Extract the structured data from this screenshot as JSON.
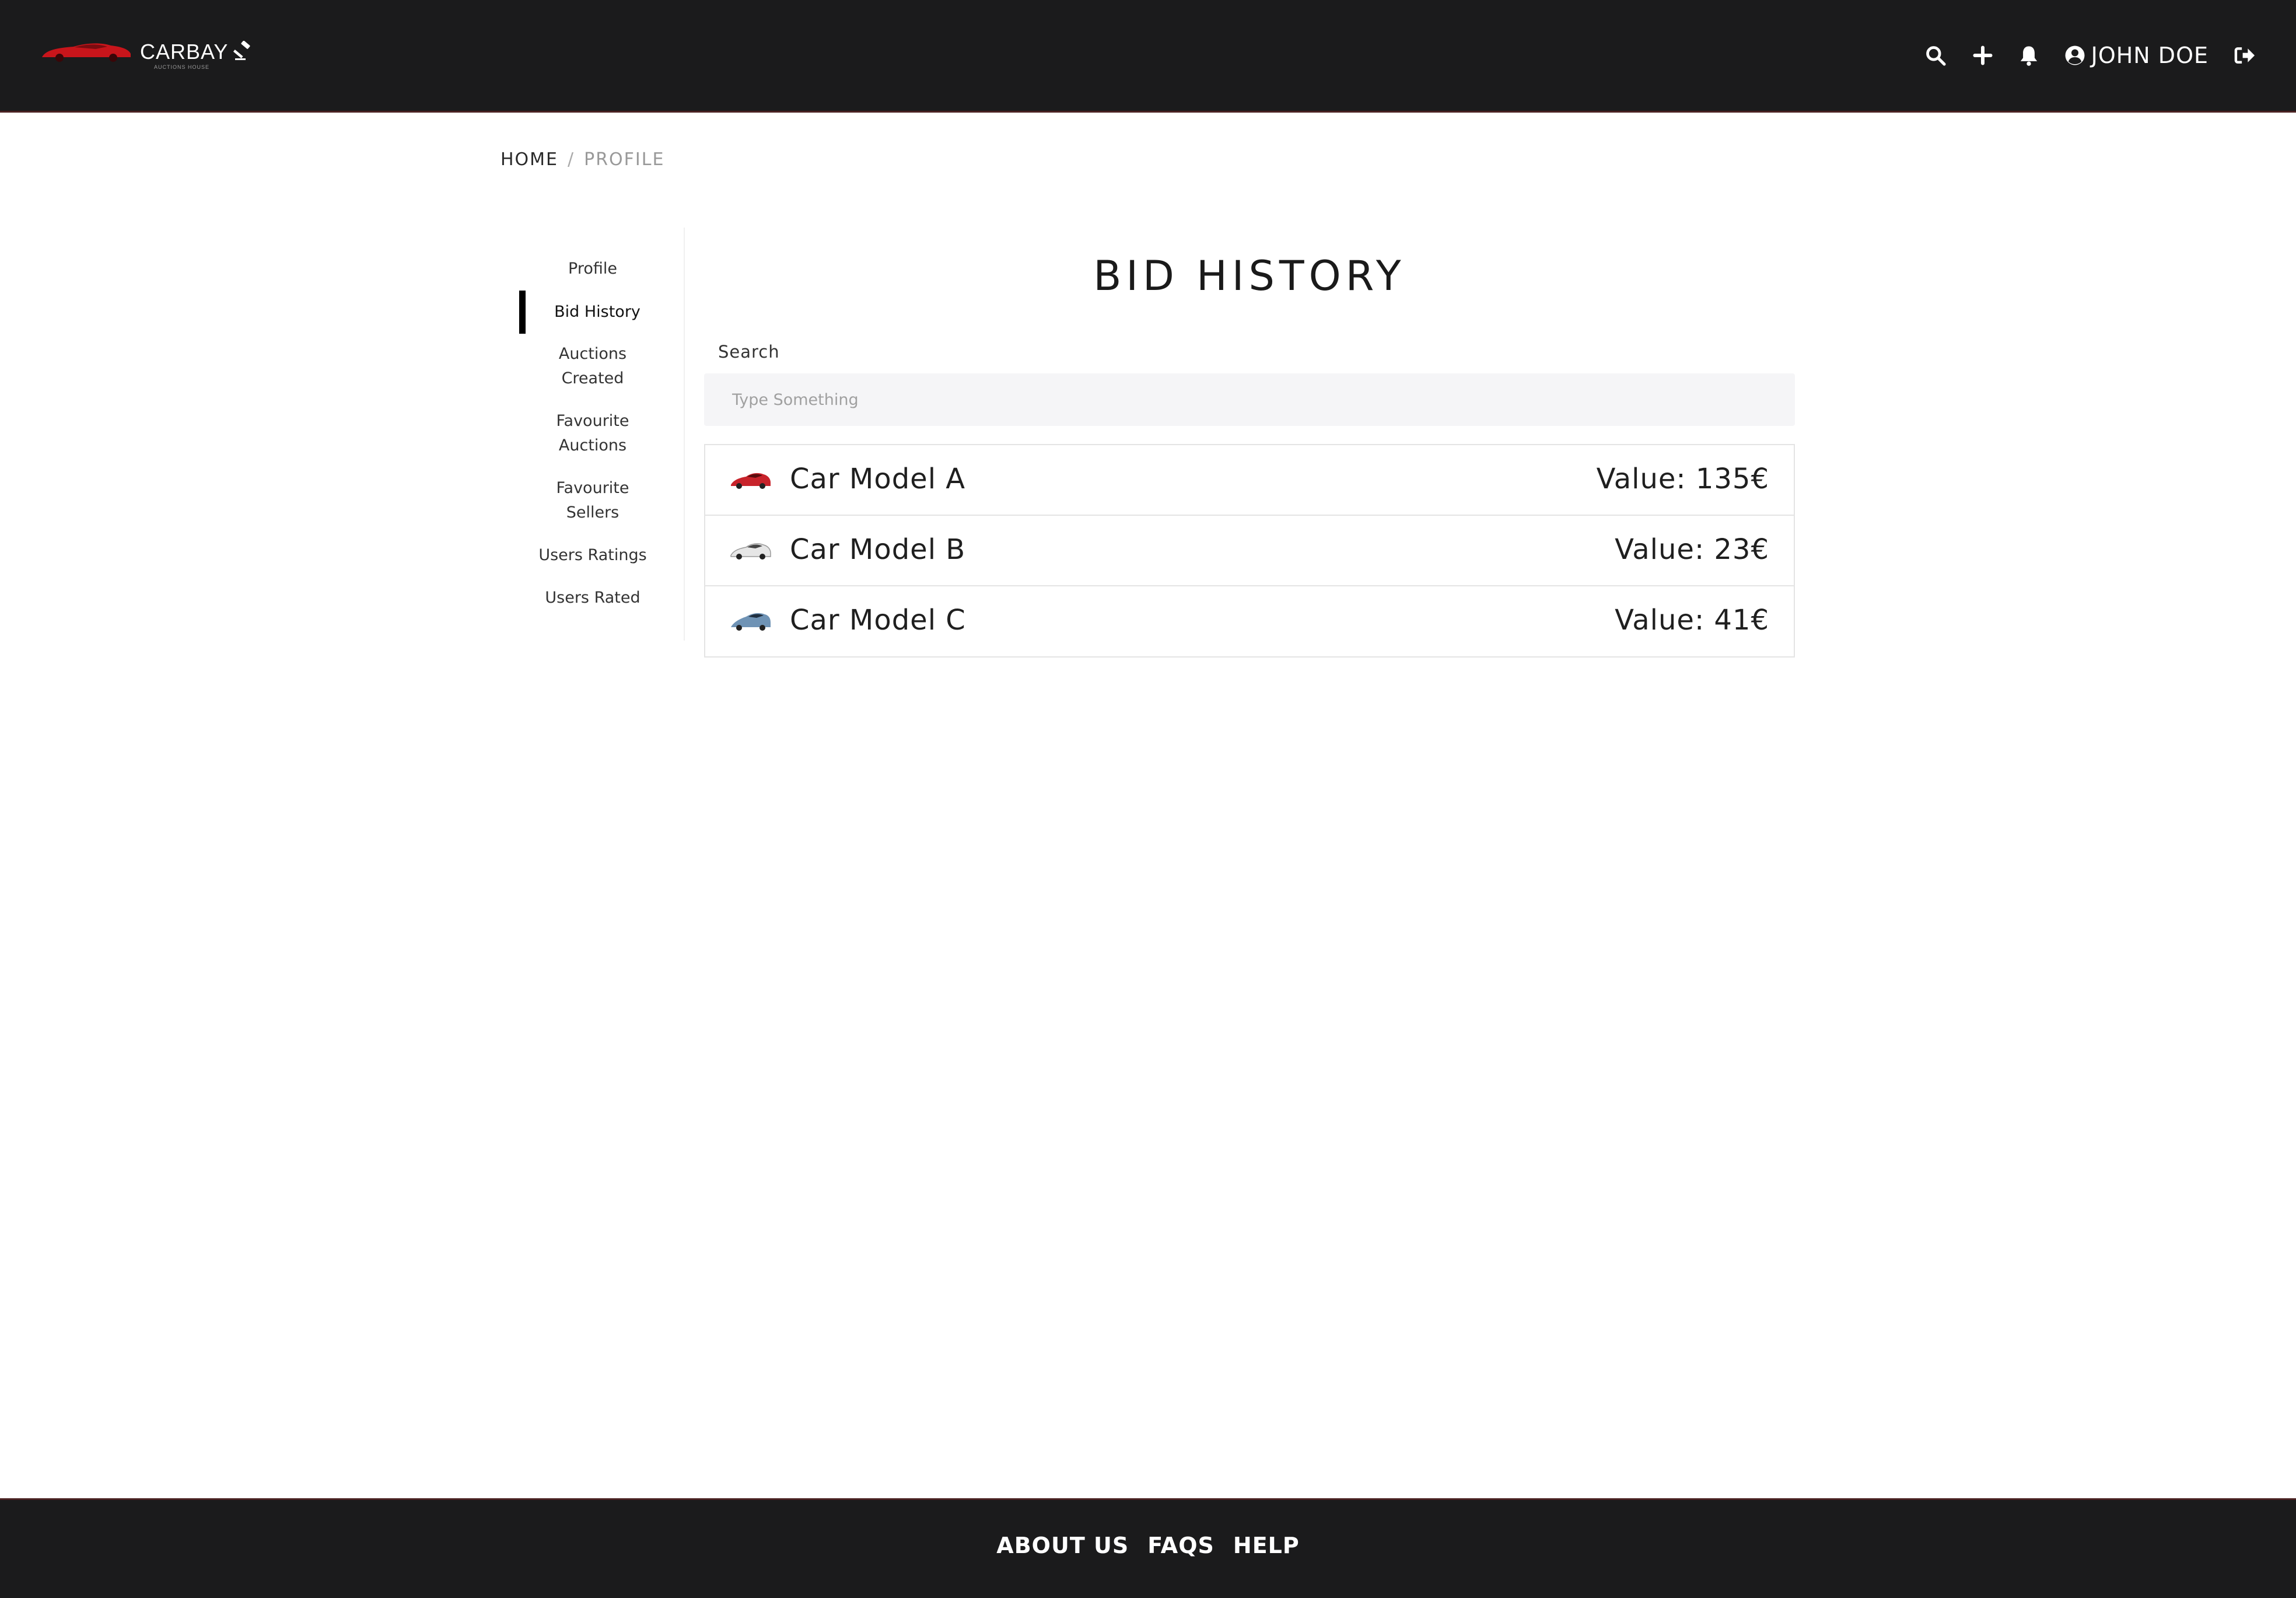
{
  "header": {
    "brand_name": "CARBAY",
    "brand_tagline": "AUCTIONS HOUSE",
    "user_name": "JOHN DOE",
    "icons": [
      "search-icon",
      "plus-icon",
      "bell-icon",
      "user-circle-icon",
      "sign-out-icon"
    ]
  },
  "breadcrumb": {
    "home": "HOME",
    "separator": "/",
    "current": "PROFILE"
  },
  "sidebar": {
    "items": [
      {
        "label": "Profile",
        "active": false
      },
      {
        "label": "Bid History",
        "active": true
      },
      {
        "label": "Auctions Created",
        "active": false
      },
      {
        "label": "Favourite Auctions",
        "active": false
      },
      {
        "label": "Favourite Sellers",
        "active": false
      },
      {
        "label": "Users Ratings",
        "active": false
      },
      {
        "label": "Users Rated",
        "active": false
      }
    ]
  },
  "main": {
    "title": "BID HISTORY",
    "search": {
      "label": "Search",
      "placeholder": "Type Something",
      "value": ""
    },
    "bids": [
      {
        "name": "Car Model A",
        "value": "Value: 135€",
        "car_color": "#c8232b"
      },
      {
        "name": "Car Model B",
        "value": "Value: 23€",
        "car_color": "#e6e6e6"
      },
      {
        "name": "Car Model C",
        "value": "Value: 41€",
        "car_color": "#6f93b5"
      }
    ]
  },
  "footer": {
    "links": [
      "ABOUT US",
      "FAQS",
      "HELP"
    ]
  },
  "colors": {
    "navbar_bg": "#1b1b1c",
    "brand_red": "#c8151b",
    "active_bar": "#000000"
  }
}
